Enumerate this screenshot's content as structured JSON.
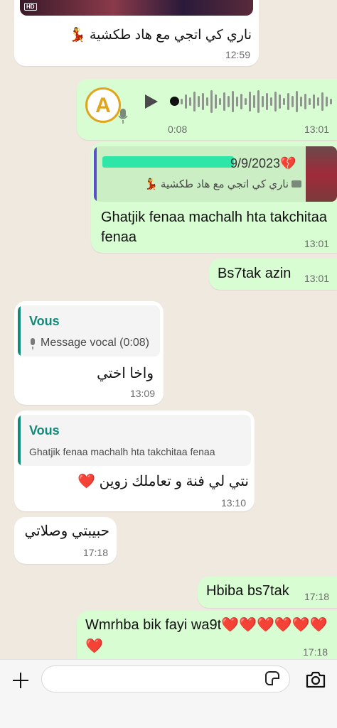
{
  "messages": {
    "m1": {
      "text": "ناري كي اتجي مع هاد طكشية 💃",
      "time": "12:59",
      "badge": "HD"
    },
    "m2": {
      "duration": "0:08",
      "time": "13:01",
      "avatar_letter": "A"
    },
    "m3": {
      "quote_date": "9/9/2023💔",
      "quote_text": "ناري كي اتجي مع هاد طكشية 💃",
      "text": "Ghatjik fenaa machalh hta takchitaa fenaa",
      "time": "13:01"
    },
    "m4": {
      "text": "Bs7tak azin",
      "time": "13:01"
    },
    "m5": {
      "quote_title": "Vous",
      "quote_text": "Message vocal (0:08)",
      "text": "واخا اختي",
      "time": "13:09"
    },
    "m6": {
      "quote_title": "Vous",
      "quote_text": "Ghatjik fenaa machalh hta takchitaa fenaa",
      "text": "نتي لي فنة و تعاملك زوين ❤️",
      "time": "13:10"
    },
    "m7": {
      "text": "حبيبتي وصلاتي",
      "time": "17:18"
    },
    "m8": {
      "text": "Hbiba bs7tak",
      "time": "17:18"
    },
    "m9": {
      "text": "Wmrhba bik fayi wa9t❤️❤️❤️❤️❤️❤️",
      "text2": "❤️",
      "time": "17:18"
    }
  },
  "colors": {
    "incoming": "#ffffff",
    "outgoing": "#d9fdd3",
    "quote_accent": "#128a79",
    "reply_bar_purple": "#5b4fc9",
    "redaction": "#2ee6a8"
  },
  "composer": {
    "input_value": ""
  }
}
